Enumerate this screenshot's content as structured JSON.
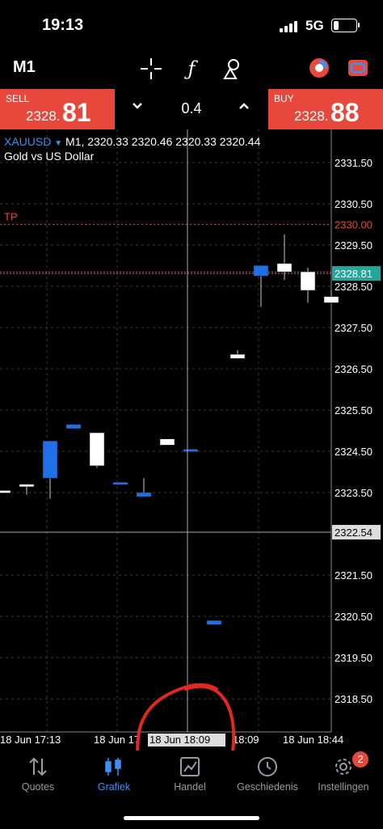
{
  "status_bar": {
    "time": "19:13",
    "network": "5G"
  },
  "toolbar": {
    "timeframe": "M1",
    "icons": [
      "crosshair-icon",
      "indicator-f-icon",
      "objects-icon",
      "one-click-trade-icon",
      "switch-icon"
    ]
  },
  "trade_bar": {
    "sell_label": "SELL",
    "sell_price_main": "2328.",
    "sell_price_big": "81",
    "buy_label": "BUY",
    "buy_price_main": "2328.",
    "buy_price_big": "88",
    "lot": "0.4",
    "down_glyph": "⌄",
    "up_glyph": "⌃"
  },
  "chart": {
    "symbol": "XAUUSD",
    "symbol_arrow": "▼",
    "ohlc_line": "M1, 2320.33 2320.46 2320.33 2320.44",
    "description": "Gold vs US Dollar",
    "tp_label": "TP"
  },
  "chart_data": {
    "type": "candlestick",
    "ylim": [
      2317.7,
      2332.3
    ],
    "yticks": [
      "2331.50",
      "2330.50",
      "2329.50",
      "2328.50",
      "2327.50",
      "2326.50",
      "2325.50",
      "2324.50",
      "2323.50",
      "2321.50",
      "2320.50",
      "2319.50",
      "2318.50"
    ],
    "xticks": [
      "18 Jun 17:13",
      "18 Jun 17",
      "18:09",
      "18 Jun 18:44"
    ],
    "cursor_time_label": "18 Jun 18:09",
    "cursor_price_label": "2322.54",
    "cursor_price": 2322.54,
    "tp_price_label": "2330.00",
    "tp_price": 2330.0,
    "bid_price_label": "2328.81",
    "bid_price": 2328.81,
    "candles": [
      {
        "x": 0,
        "open": 2323.55,
        "close": 2323.55,
        "high": 2323.55,
        "low": 2323.55,
        "color": "white"
      },
      {
        "x": 1,
        "open": 2323.65,
        "close": 2323.7,
        "high": 2323.7,
        "low": 2323.45,
        "color": "white"
      },
      {
        "x": 2,
        "open": 2323.85,
        "close": 2324.75,
        "high": 2324.75,
        "low": 2323.35,
        "color": "blue"
      },
      {
        "x": 3,
        "open": 2325.05,
        "close": 2325.15,
        "high": 2325.15,
        "low": 2325.05,
        "color": "blue"
      },
      {
        "x": 4,
        "open": 2324.95,
        "close": 2324.15,
        "high": 2324.95,
        "low": 2324.1,
        "color": "white"
      },
      {
        "x": 5,
        "open": 2323.7,
        "close": 2323.75,
        "high": 2323.75,
        "low": 2323.7,
        "color": "blue"
      },
      {
        "x": 6,
        "open": 2323.4,
        "close": 2323.5,
        "high": 2323.85,
        "low": 2323.4,
        "color": "blue"
      },
      {
        "x": 7,
        "open": 2324.8,
        "close": 2324.65,
        "high": 2324.8,
        "low": 2324.65,
        "color": "white"
      },
      {
        "x": 8,
        "open": 2324.5,
        "close": 2324.55,
        "high": 2324.55,
        "low": 2324.5,
        "color": "blue"
      },
      {
        "x": 9,
        "open": 2320.3,
        "close": 2320.4,
        "high": 2320.4,
        "low": 2320.3,
        "color": "blue"
      },
      {
        "x": 10,
        "open": 2326.85,
        "close": 2326.75,
        "high": 2326.95,
        "low": 2326.75,
        "color": "white"
      },
      {
        "x": 11,
        "open": 2328.75,
        "close": 2329.0,
        "high": 2329.0,
        "low": 2328.0,
        "color": "blue"
      },
      {
        "x": 12,
        "open": 2329.05,
        "close": 2328.85,
        "high": 2329.75,
        "low": 2328.65,
        "color": "white"
      },
      {
        "x": 13,
        "open": 2328.85,
        "close": 2328.4,
        "high": 2328.95,
        "low": 2328.1,
        "color": "white"
      },
      {
        "x": 14,
        "open": 2328.25,
        "close": 2328.1,
        "high": 2328.4,
        "low": 2328.1,
        "color": "white"
      }
    ],
    "colors": {
      "up": "#1f6fe8",
      "down": "#ffffff",
      "tp": "#e8483c",
      "bid": "#26a69a",
      "grid": "#3a3a3a"
    }
  },
  "nav": {
    "items": [
      {
        "label": "Quotes",
        "icon": "quotes-arrows-icon"
      },
      {
        "label": "Grafiek",
        "icon": "chart-candles-icon"
      },
      {
        "label": "Handel",
        "icon": "trade-chart-icon"
      },
      {
        "label": "Geschiedenis",
        "icon": "history-clock-icon"
      },
      {
        "label": "Instellingen",
        "icon": "settings-gear-icon"
      }
    ],
    "badge": "2"
  },
  "colors": {
    "accent": "#3e8ef7",
    "sell_buy": "#e8483c",
    "annotation": "#e0281e"
  }
}
